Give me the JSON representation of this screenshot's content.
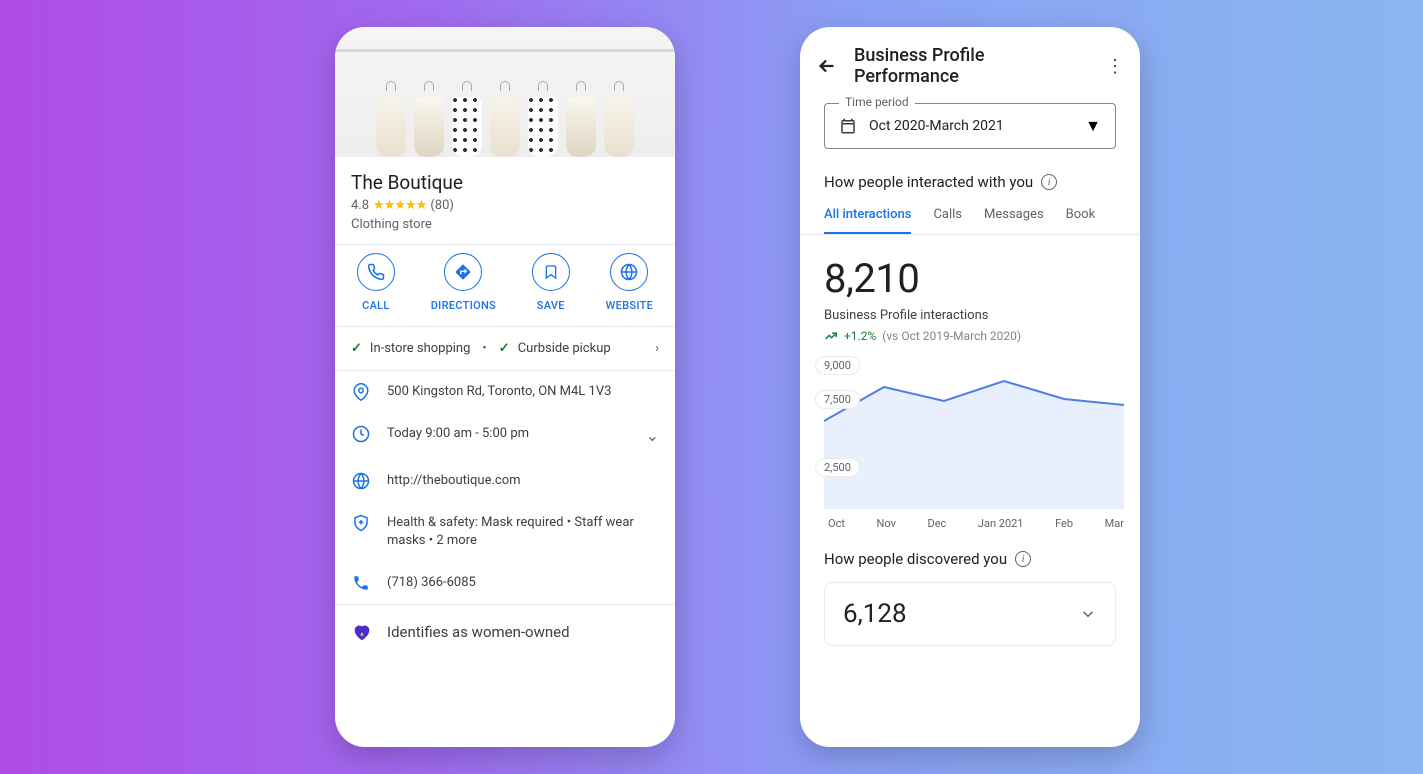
{
  "phone1": {
    "business_name": "The Boutique",
    "rating": "4.8",
    "review_count": "(80)",
    "category": "Clothing store",
    "actions": {
      "call": "CALL",
      "directions": "DIRECTIONS",
      "save": "SAVE",
      "website": "WEBSITE"
    },
    "features": {
      "instore": "In-store shopping",
      "curbside": "Curbside pickup"
    },
    "address": "500 Kingston Rd, Toronto, ON M4L 1V3",
    "hours": "Today 9:00 am - 5:00 pm",
    "url": "http://theboutique.com",
    "safety": "Health & safety: Mask required • Staff wear masks • 2 more",
    "phone": "(718) 366-6085",
    "women_owned": "Identifies as women-owned"
  },
  "phone2": {
    "header_title": "Business Profile Performance",
    "time_legend": "Time period",
    "time_value": "Oct 2020-March 2021",
    "section_interacted": "How people interacted with you",
    "tabs": {
      "all": "All interactions",
      "calls": "Calls",
      "messages": "Messages",
      "bookings": "Book"
    },
    "metric_value": "8,210",
    "metric_label": "Business Profile interactions",
    "trend_pct": "+1.2%",
    "trend_compare": "(vs Oct 2019-March 2020)",
    "section_discovered": "How people discovered you",
    "discovered_value": "6,128"
  },
  "chart_data": {
    "type": "line",
    "title": "Business Profile interactions",
    "categories": [
      "Oct",
      "Nov",
      "Dec",
      "Jan 2021",
      "Feb",
      "Mar"
    ],
    "values": [
      6800,
      8500,
      7800,
      8800,
      7900,
      7600
    ],
    "ylabel": "",
    "ylim": [
      0,
      10000
    ],
    "yticks": [
      2500,
      7500,
      9000
    ]
  }
}
